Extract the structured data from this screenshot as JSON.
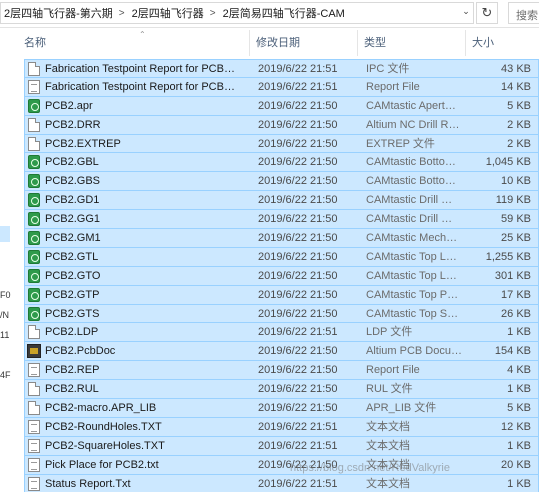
{
  "address": {
    "crumbs": [
      "2层四轴飞行器-第六期",
      "2层四轴飞行器",
      "2层简易四轴飞行器-CAM"
    ],
    "separator": ">",
    "search_placeholder": "搜索"
  },
  "left_pane": [
    "F0",
    "/N",
    "11",
    "4F"
  ],
  "columns": {
    "name": "名称",
    "date": "修改日期",
    "type": "类型",
    "size": "大小"
  },
  "files": [
    {
      "name": "Fabrication Testpoint Report for PCB…",
      "date": "2019/6/22 21:51",
      "type": "IPC 文件",
      "size": "43 KB",
      "icon": "document-icon"
    },
    {
      "name": "Fabrication Testpoint Report for PCB…",
      "date": "2019/6/22 21:51",
      "type": "Report File",
      "size": "14 KB",
      "icon": "text-file-icon"
    },
    {
      "name": "PCB2.apr",
      "date": "2019/6/22 21:50",
      "type": "CAMtastic Apert…",
      "size": "5 KB",
      "icon": "camtastic-icon"
    },
    {
      "name": "PCB2.DRR",
      "date": "2019/6/22 21:50",
      "type": "Altium NC Drill R…",
      "size": "2 KB",
      "icon": "document-icon"
    },
    {
      "name": "PCB2.EXTREP",
      "date": "2019/6/22 21:50",
      "type": "EXTREP 文件",
      "size": "2 KB",
      "icon": "document-icon"
    },
    {
      "name": "PCB2.GBL",
      "date": "2019/6/22 21:50",
      "type": "CAMtastic Botto…",
      "size": "1,045 KB",
      "icon": "camtastic-icon"
    },
    {
      "name": "PCB2.GBS",
      "date": "2019/6/22 21:50",
      "type": "CAMtastic Botto…",
      "size": "10 KB",
      "icon": "camtastic-icon"
    },
    {
      "name": "PCB2.GD1",
      "date": "2019/6/22 21:50",
      "type": "CAMtastic Drill …",
      "size": "119 KB",
      "icon": "camtastic-icon"
    },
    {
      "name": "PCB2.GG1",
      "date": "2019/6/22 21:50",
      "type": "CAMtastic Drill …",
      "size": "59 KB",
      "icon": "camtastic-icon"
    },
    {
      "name": "PCB2.GM1",
      "date": "2019/6/22 21:50",
      "type": "CAMtastic Mech…",
      "size": "25 KB",
      "icon": "camtastic-icon"
    },
    {
      "name": "PCB2.GTL",
      "date": "2019/6/22 21:50",
      "type": "CAMtastic Top L…",
      "size": "1,255 KB",
      "icon": "camtastic-icon"
    },
    {
      "name": "PCB2.GTO",
      "date": "2019/6/22 21:50",
      "type": "CAMtastic Top L…",
      "size": "301 KB",
      "icon": "camtastic-icon"
    },
    {
      "name": "PCB2.GTP",
      "date": "2019/6/22 21:50",
      "type": "CAMtastic Top P…",
      "size": "17 KB",
      "icon": "camtastic-icon"
    },
    {
      "name": "PCB2.GTS",
      "date": "2019/6/22 21:50",
      "type": "CAMtastic Top S…",
      "size": "26 KB",
      "icon": "camtastic-icon"
    },
    {
      "name": "PCB2.LDP",
      "date": "2019/6/22 21:51",
      "type": "LDP 文件",
      "size": "1 KB",
      "icon": "document-icon"
    },
    {
      "name": "PCB2.PcbDoc",
      "date": "2019/6/22 21:50",
      "type": "Altium PCB Docu…",
      "size": "154 KB",
      "icon": "pcb-document-icon"
    },
    {
      "name": "PCB2.REP",
      "date": "2019/6/22 21:50",
      "type": "Report File",
      "size": "4 KB",
      "icon": "text-file-icon"
    },
    {
      "name": "PCB2.RUL",
      "date": "2019/6/22 21:50",
      "type": "RUL 文件",
      "size": "1 KB",
      "icon": "document-icon"
    },
    {
      "name": "PCB2-macro.APR_LIB",
      "date": "2019/6/22 21:50",
      "type": "APR_LIB 文件",
      "size": "5 KB",
      "icon": "document-icon"
    },
    {
      "name": "PCB2-RoundHoles.TXT",
      "date": "2019/6/22 21:51",
      "type": "文本文档",
      "size": "12 KB",
      "icon": "text-file-icon"
    },
    {
      "name": "PCB2-SquareHoles.TXT",
      "date": "2019/6/22 21:51",
      "type": "文本文档",
      "size": "1 KB",
      "icon": "text-file-icon"
    },
    {
      "name": "Pick Place for PCB2.txt",
      "date": "2019/6/22 21:50",
      "type": "文本文档",
      "size": "20 KB",
      "icon": "text-file-icon"
    },
    {
      "name": "Status Report.Txt",
      "date": "2019/6/22 21:51",
      "type": "文本文档",
      "size": "1 KB",
      "icon": "text-file-icon"
    }
  ],
  "watermark": "https://blog.csdn.net/RedValkyrie",
  "colors": {
    "selection": "#cce8ff",
    "selection_border": "#99d1ff",
    "header_text": "#4c607a",
    "camtastic": "#2e9a4b"
  }
}
